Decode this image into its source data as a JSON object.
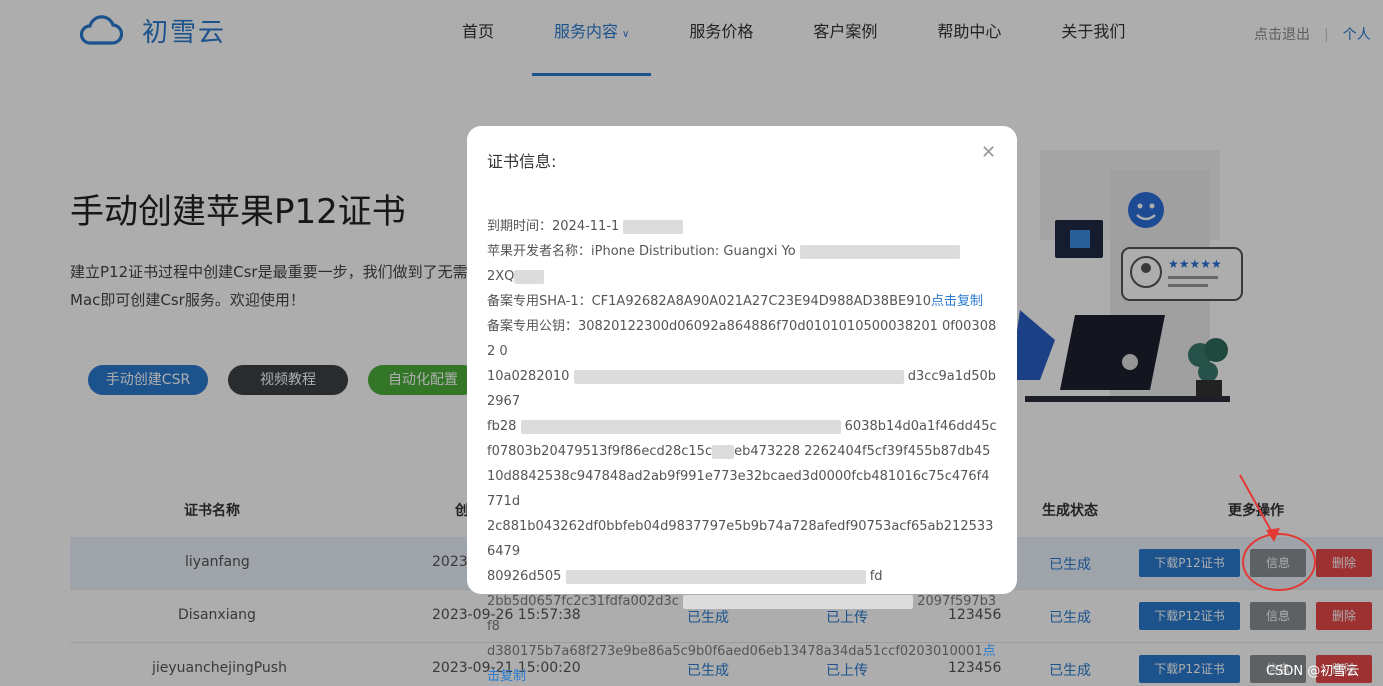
{
  "header": {
    "brand": "初雪云",
    "nav": [
      {
        "label": "首页"
      },
      {
        "label": "服务内容"
      },
      {
        "label": "服务价格"
      },
      {
        "label": "客户案例"
      },
      {
        "label": "帮助中心"
      },
      {
        "label": "关于我们"
      }
    ],
    "logout": "点击退出",
    "user": "个人"
  },
  "hero": {
    "title": "手动创建苹果P12证书",
    "desc": "建立P12证书过程中创建Csr是最重要一步，我们做到了无需Mac即可创建Csr服务。欢迎使用！",
    "btn_csr": "手动创建CSR",
    "btn_video": "视频教程",
    "btn_auto": "自动化配置"
  },
  "table": {
    "headers": {
      "name": "证书名称",
      "created": "创",
      "status": "生成状态",
      "more": "更多操作"
    },
    "rows": [
      {
        "name": "liyanfang",
        "date": "2023-",
        "gen": "",
        "upload": "",
        "pwd": "",
        "status": "已生成"
      },
      {
        "name": "Disanxiang",
        "date": "2023-09-26 15:57:38",
        "gen": "已生成",
        "upload": "已上传",
        "pwd": "123456",
        "status": "已生成"
      },
      {
        "name": "jieyuanchejingPush",
        "date": "2023-09-21 15:00:20",
        "gen": "已生成",
        "upload": "已上传",
        "pwd": "123456",
        "status": "已生成"
      }
    ],
    "btn_download": "下载P12证书",
    "btn_info": "信息",
    "btn_delete": "删除"
  },
  "modal": {
    "title": "证书信息:",
    "expire_label": "到期时间：",
    "expire_value": "2024-11-1",
    "dev_label": "苹果开发者名称：",
    "dev_value": "iPhone Distribution: Guangxi Yo",
    "dev_value2": "2XQ",
    "sha1_label": "备案专用SHA-1：",
    "sha1_value": "CF1A92682A8A90A021A27C23E94D988AD38BE910",
    "copy": "点击复制",
    "pubkey_label": "备案专用公钥：",
    "pubkey_line1": "30820122300d06092a864886f70d0101010500038201 0f003082 0",
    "pubkey_line2": "10a0282010",
    "pubkey_line2b": "d3cc9a1d50b2967",
    "pubkey_line3": "fb28",
    "pubkey_line3b": "6038b14d0a1f46dd45c",
    "pubkey_line4": "f07803b20479513f9f86ecd28c15c",
    "pubkey_line4b": "eb473228 2262404f5cf39f455b87db45",
    "pubkey_line5": "10d8842538c947848ad2ab9f991e773e32bcaed3d0000fcb481016c75c476f4771d",
    "pubkey_line6": "2c881b043262df0bbfeb04d9837797e5b9b74a728afedf90753acf65ab2125336479",
    "pubkey_line7": "80926d505",
    "pubkey_line7b": "fd",
    "pubkey_line8": "2bb5d0657fc2c31fdfa002d3c",
    "pubkey_line8b": "2097f597b3f8",
    "pubkey_line9": "d380175b7a68f273e9be86a5c9b0f6aed06eb13478a34da51ccf0203010001"
  },
  "watermark": "CSDN @初雪云",
  "colors": {
    "accent": "#2a7bd0",
    "danger": "#e8494b",
    "success": "#4caf3a"
  }
}
